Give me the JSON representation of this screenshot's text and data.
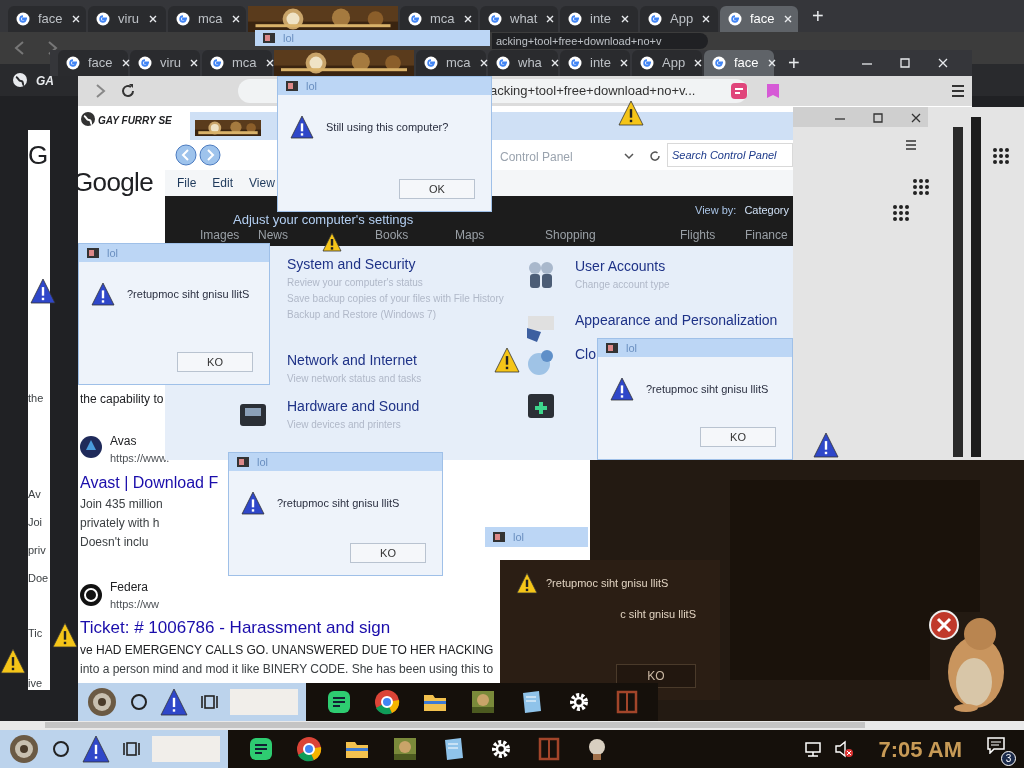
{
  "back_browser": {
    "tabs": [
      {
        "title": "face",
        "selected": false
      },
      {
        "title": "viru",
        "selected": false
      },
      {
        "title": "mca",
        "selected": false
      },
      {
        "kind": "picture",
        "selected": false
      },
      {
        "title": "mca",
        "selected": false
      },
      {
        "title": "what",
        "selected": false
      },
      {
        "title": "inte",
        "selected": false
      },
      {
        "title": "App",
        "selected": false
      },
      {
        "title": "face",
        "selected": true
      }
    ],
    "new_tab": "+",
    "url": "acking+tool+free+download+no+v",
    "bookmark": "GA"
  },
  "front_browser": {
    "tabs": [
      {
        "title": "face",
        "selected": false
      },
      {
        "title": "viru",
        "selected": false
      },
      {
        "title": "mca",
        "selected": false
      },
      {
        "kind": "picture",
        "selected": false
      },
      {
        "title": "mca",
        "selected": false
      },
      {
        "title": "wha",
        "selected": false
      },
      {
        "title": "inte",
        "selected": false
      },
      {
        "title": "App",
        "selected": false
      },
      {
        "title": "face",
        "selected": true
      }
    ],
    "new_tab": "+",
    "url": "acking+tool+free+download+no+v...",
    "bookmark": "GAY FURRY SE"
  },
  "left_page": {
    "texts": [
      "G",
      "the",
      "Av",
      "Joi",
      "priv",
      "Doe",
      "Tic",
      "ive"
    ]
  },
  "search_page": {
    "logo": "Google",
    "nav": [
      "Images",
      "News",
      "Books",
      "Maps",
      "Shopping",
      "Flights",
      "Finance"
    ],
    "snippet": "the capability to",
    "results": [
      {
        "site": "Avas",
        "url": "https://www.",
        "title": "Avast | Download F",
        "lines": [
          "Join 435 million",
          "privately with h",
          "Doesn't inclu"
        ]
      },
      {
        "site": "Federa",
        "url": "https://ww",
        "title": "Ticket: # 1006786 - Harassment and sign",
        "lines": [
          "ve HAD EMERGENCY CALLS GO. UNANSWERED DUE TO HER HACKING",
          "into a person mind and mod it like BINERY CODE. She has been using this to"
        ]
      }
    ]
  },
  "control_panel": {
    "address": "Control Panel",
    "search": {
      "placeholder": "Search Control Panel"
    },
    "menu": [
      "File",
      "Edit",
      "View"
    ],
    "heading": "Adjust your computer's settings",
    "view_by_label": "View by:",
    "view_by": "Category",
    "categories": [
      {
        "title": "System and Security",
        "links": [
          "Review your computer's status",
          "Save backup copies of your files with File History",
          "Backup and Restore (Windows 7)"
        ]
      },
      {
        "title": "Network and Internet",
        "links": [
          "View network status and tasks"
        ]
      },
      {
        "title": "Hardware and Sound",
        "links": [
          "View devices and printers"
        ]
      },
      {
        "title": "User Accounts",
        "links": [
          "Change account type"
        ]
      },
      {
        "title": "Appearance and Personalization"
      },
      {
        "title": "Clo"
      }
    ]
  },
  "dialogs": [
    {
      "kind": "light",
      "title": "lol",
      "message": "Still using this computer?",
      "button": "OK"
    },
    {
      "kind": "light",
      "title": "lol",
      "message": "?retupmoc siht gnisu llitS",
      "button": "KO"
    },
    {
      "kind": "light",
      "title": "lol",
      "message": "?retupmoc siht gnisu llitS",
      "button": "KO"
    },
    {
      "kind": "light",
      "title": "lol",
      "message": "?retupmoc siht gnisu llitS",
      "button": "KO"
    },
    {
      "kind": "title_only",
      "title": "lol"
    },
    {
      "kind": "title_only",
      "title": "lol"
    },
    {
      "kind": "dark",
      "message": "?retupmoc siht gnisu llitS",
      "message_2": "c siht gnisu llitS",
      "button": "KO"
    }
  ],
  "taskbar": {
    "clock": "7:05 AM",
    "notifications": "3"
  }
}
